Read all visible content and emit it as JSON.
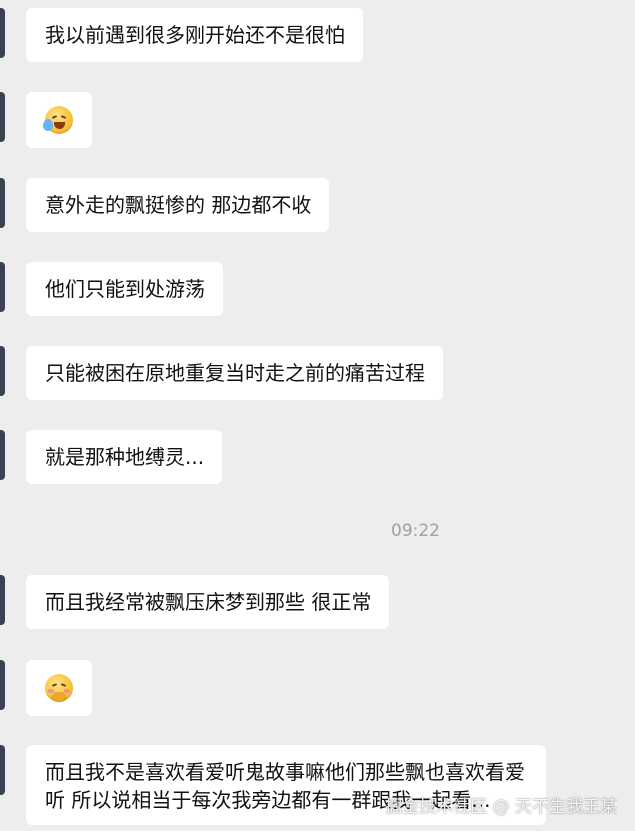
{
  "messages": [
    {
      "type": "text",
      "text": "我以前遇到很多刚开始还不是很怕"
    },
    {
      "type": "emoji",
      "emoji": "crying-laughing-emoji"
    },
    {
      "type": "text",
      "text": "意外走的飘挺惨的 那边都不收"
    },
    {
      "type": "text",
      "text": "他们只能到处游荡"
    },
    {
      "type": "text",
      "text": "只能被困在原地重复当时走之前的痛苦过程"
    },
    {
      "type": "text",
      "text": "就是那种地缚灵..."
    },
    {
      "type": "time",
      "text": "09:22"
    },
    {
      "type": "text",
      "text": "而且我经常被飘压床梦到那些 很正常"
    },
    {
      "type": "emoji",
      "emoji": "shy-emoji"
    },
    {
      "type": "text",
      "text": "而且我不是喜欢看爱听鬼故事嘛他们那些飘也喜欢看爱听 所以说相当于每次我旁边都有一群跟我一起看..."
    }
  ],
  "watermark": "掘金技术社区 @ 天不生我王某",
  "colors": {
    "background": "#ededed",
    "bubble": "#ffffff",
    "text": "#111111",
    "timestamp": "#a0a0a0",
    "avatar": "#3a4252"
  }
}
